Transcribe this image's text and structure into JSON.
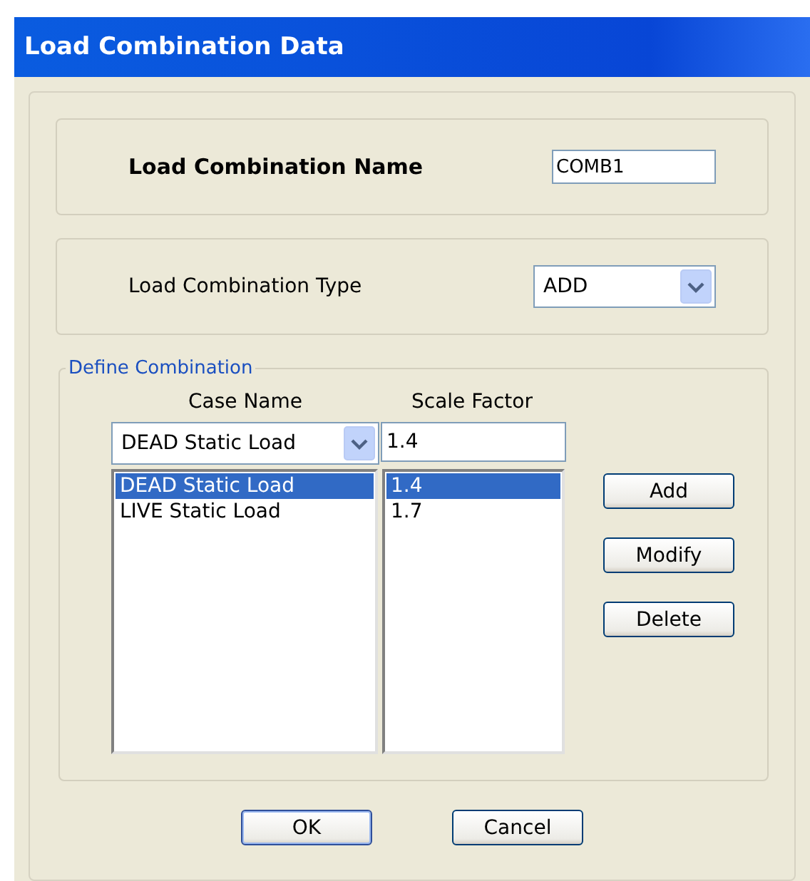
{
  "window": {
    "title": "Load Combination Data"
  },
  "name_group": {
    "label": "Load Combination Name",
    "value": "COMB1"
  },
  "type_group": {
    "label": "Load Combination Type",
    "value": "ADD"
  },
  "define_combination": {
    "legend": "Define Combination",
    "case_name_header": "Case Name",
    "scale_factor_header": "Scale Factor",
    "case_select": "DEAD Static Load",
    "scale_input": "1.4",
    "rows": [
      {
        "case": "DEAD Static Load",
        "factor": "1.4",
        "selected": true
      },
      {
        "case": "LIVE Static Load",
        "factor": "1.7",
        "selected": false
      }
    ],
    "buttons": [
      "Add",
      "Modify",
      "Delete"
    ]
  },
  "buttons": [
    {
      "label": "OK",
      "default": true
    },
    {
      "label": "Cancel",
      "default": false
    }
  ]
}
